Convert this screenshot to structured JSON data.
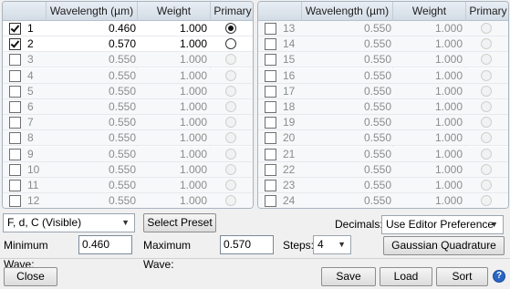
{
  "table": {
    "columns": {
      "wavelength": "Wavelength (µm)",
      "weight": "Weight",
      "primary": "Primary"
    },
    "left_rows": [
      {
        "num": "1",
        "checked": true,
        "wavelength": "0.460",
        "weight": "1.000",
        "primary": true,
        "active": true
      },
      {
        "num": "2",
        "checked": true,
        "wavelength": "0.570",
        "weight": "1.000",
        "primary": false,
        "active": true
      },
      {
        "num": "3",
        "checked": false,
        "wavelength": "0.550",
        "weight": "1.000",
        "primary": false,
        "active": false
      },
      {
        "num": "4",
        "checked": false,
        "wavelength": "0.550",
        "weight": "1.000",
        "primary": false,
        "active": false
      },
      {
        "num": "5",
        "checked": false,
        "wavelength": "0.550",
        "weight": "1.000",
        "primary": false,
        "active": false
      },
      {
        "num": "6",
        "checked": false,
        "wavelength": "0.550",
        "weight": "1.000",
        "primary": false,
        "active": false
      },
      {
        "num": "7",
        "checked": false,
        "wavelength": "0.550",
        "weight": "1.000",
        "primary": false,
        "active": false
      },
      {
        "num": "8",
        "checked": false,
        "wavelength": "0.550",
        "weight": "1.000",
        "primary": false,
        "active": false
      },
      {
        "num": "9",
        "checked": false,
        "wavelength": "0.550",
        "weight": "1.000",
        "primary": false,
        "active": false
      },
      {
        "num": "10",
        "checked": false,
        "wavelength": "0.550",
        "weight": "1.000",
        "primary": false,
        "active": false
      },
      {
        "num": "11",
        "checked": false,
        "wavelength": "0.550",
        "weight": "1.000",
        "primary": false,
        "active": false
      },
      {
        "num": "12",
        "checked": false,
        "wavelength": "0.550",
        "weight": "1.000",
        "primary": false,
        "active": false
      }
    ],
    "right_rows": [
      {
        "num": "13",
        "checked": false,
        "wavelength": "0.550",
        "weight": "1.000",
        "primary": false,
        "active": false
      },
      {
        "num": "14",
        "checked": false,
        "wavelength": "0.550",
        "weight": "1.000",
        "primary": false,
        "active": false
      },
      {
        "num": "15",
        "checked": false,
        "wavelength": "0.550",
        "weight": "1.000",
        "primary": false,
        "active": false
      },
      {
        "num": "16",
        "checked": false,
        "wavelength": "0.550",
        "weight": "1.000",
        "primary": false,
        "active": false
      },
      {
        "num": "17",
        "checked": false,
        "wavelength": "0.550",
        "weight": "1.000",
        "primary": false,
        "active": false
      },
      {
        "num": "18",
        "checked": false,
        "wavelength": "0.550",
        "weight": "1.000",
        "primary": false,
        "active": false
      },
      {
        "num": "19",
        "checked": false,
        "wavelength": "0.550",
        "weight": "1.000",
        "primary": false,
        "active": false
      },
      {
        "num": "20",
        "checked": false,
        "wavelength": "0.550",
        "weight": "1.000",
        "primary": false,
        "active": false
      },
      {
        "num": "21",
        "checked": false,
        "wavelength": "0.550",
        "weight": "1.000",
        "primary": false,
        "active": false
      },
      {
        "num": "22",
        "checked": false,
        "wavelength": "0.550",
        "weight": "1.000",
        "primary": false,
        "active": false
      },
      {
        "num": "23",
        "checked": false,
        "wavelength": "0.550",
        "weight": "1.000",
        "primary": false,
        "active": false
      },
      {
        "num": "24",
        "checked": false,
        "wavelength": "0.550",
        "weight": "1.000",
        "primary": false,
        "active": false
      }
    ]
  },
  "controls": {
    "preset_value": "F, d, C (Visible)",
    "select_preset_label": "Select Preset",
    "decimals_label": "Decimals:",
    "decimals_value": "Use Editor Preference",
    "min_wave_label": "Minimum Wave:",
    "min_wave_value": "0.460",
    "max_wave_label": "Maximum Wave:",
    "max_wave_value": "0.570",
    "steps_label": "Steps:",
    "steps_value": "4",
    "gaussian_label": "Gaussian Quadrature"
  },
  "footer": {
    "close_label": "Close",
    "save_label": "Save",
    "load_label": "Load",
    "sort_label": "Sort",
    "help_glyph": "?"
  },
  "icons": {
    "dropdown": "chevron-down-icon",
    "help": "help-icon"
  }
}
